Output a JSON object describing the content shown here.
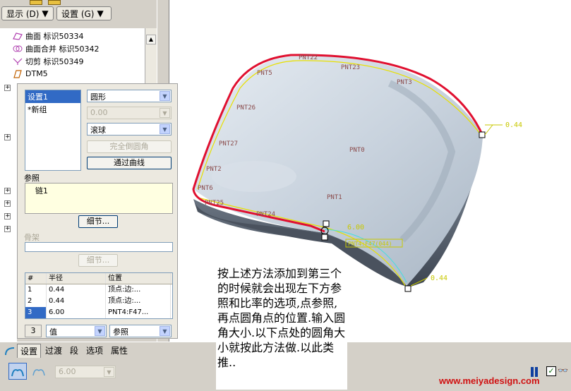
{
  "toolbar": {
    "display_label": "显示 (D)",
    "settings_label": "设置 (G)"
  },
  "tree": {
    "items": [
      {
        "label": "曲面 标识50334"
      },
      {
        "label": "曲面合并 标识50342"
      },
      {
        "label": "切剪 标识50349"
      },
      {
        "label": "DTM5"
      }
    ]
  },
  "panel": {
    "sets": [
      "设置1",
      "*新组"
    ],
    "shape_value": "圆形",
    "disabled_value": "0.00",
    "type_value": "滚球",
    "full_round_button": "完全倒圆角",
    "through_curve_button": "通过曲线",
    "reference_label": "参照",
    "reference_item": "链1",
    "details_button": "细节...",
    "skeleton_label": "骨架",
    "skeleton_details_button": "细节...",
    "table": {
      "headers": [
        "#",
        "半径",
        "位置"
      ],
      "rows": [
        {
          "num": "1",
          "radius": "0.44",
          "location": "顶点:边:..."
        },
        {
          "num": "2",
          "radius": "0.44",
          "location": "顶点:边:..."
        },
        {
          "num": "3",
          "radius": "6.00",
          "location": "PNT4:F47..."
        }
      ]
    },
    "count": "3",
    "value_mode": "值",
    "ref_mode": "参照"
  },
  "tabs": {
    "items": [
      "设置",
      "过渡",
      "段",
      "选项",
      "属性"
    ]
  },
  "status": {
    "radius_value": "6.00"
  },
  "viewport": {
    "points": [
      "PNT22",
      "PNT23",
      "PNT3",
      "PNT5",
      "PNT26",
      "PNT0",
      "PNT27",
      "PNT2",
      "PNT1",
      "PNT6",
      "PNT25",
      "PNT24"
    ],
    "dims": [
      "0.44",
      "6.00",
      "0.44"
    ],
    "edge_label": "PNT4:F47(044)"
  },
  "caption": "按上述方法添加到第三个的时候就会出现左下方参照和比率的选项,点参照,再点圆角点的位置.输入圆角大小.以下点处的圆角大小就按此方法做.以此类推..",
  "watermark": "www.meiyadesign.com",
  "colors": {
    "edge_highlight": "#e01030",
    "curve_yellow": "#e8e000",
    "surface": "#c8d2dc",
    "selection": "#316ac5"
  }
}
